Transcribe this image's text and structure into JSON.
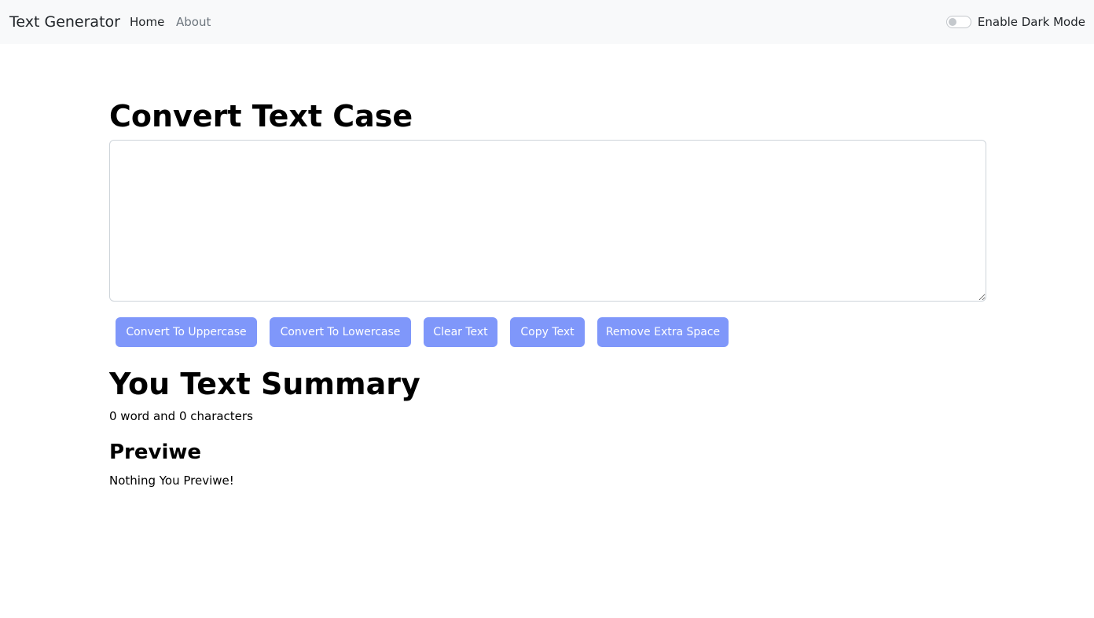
{
  "navbar": {
    "brand": "Text Generator",
    "links": [
      {
        "label": "Home"
      },
      {
        "label": "About"
      }
    ],
    "dark_mode_label": "Enable Dark Mode",
    "dark_mode_enabled": false
  },
  "main": {
    "title": "Convert Text Case",
    "textarea_value": "",
    "buttons": {
      "uppercase": "Convert To Uppercase",
      "lowercase": "Convert To Lowercase",
      "clear": "Clear Text",
      "copy": "Copy Text",
      "remove_space": "Remove Extra Space"
    },
    "summary_title": "You Text Summary",
    "summary_text": "0 word and 0 characters",
    "preview_title": "Previwe",
    "preview_text": "Nothing You Previwe!"
  },
  "colors": {
    "navbar_bg": "#f8f9fa",
    "button_bg": "#7f97fa",
    "button_text": "#ffffff",
    "link_active": "#212529",
    "link_muted": "#6c757d"
  }
}
